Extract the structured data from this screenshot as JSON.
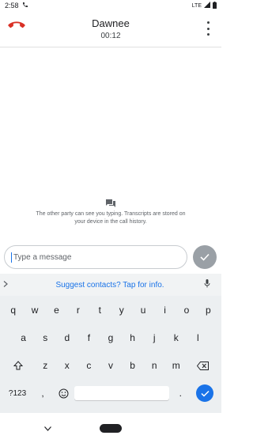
{
  "status_bar": {
    "time": "2:58",
    "network": "LTE"
  },
  "call": {
    "caller_name": "Dawnee",
    "duration": "00:12"
  },
  "transcript_notice": "The other party can see you typing. Transcripts are stored on your device in the call history.",
  "compose": {
    "placeholder": "Type a message"
  },
  "suggestion": {
    "text": "Suggest contacts? Tap for info."
  },
  "keyboard": {
    "row1": [
      "q",
      "w",
      "e",
      "r",
      "t",
      "y",
      "u",
      "i",
      "o",
      "p"
    ],
    "row2": [
      "a",
      "s",
      "d",
      "f",
      "g",
      "h",
      "j",
      "k",
      "l"
    ],
    "row3": [
      "z",
      "x",
      "c",
      "v",
      "b",
      "n",
      "m"
    ],
    "symbols_label": "?123",
    "comma": ",",
    "period": "."
  },
  "colors": {
    "accent": "#1a73e8",
    "hangup": "#d93025",
    "send_disabled": "#9aa0a6"
  }
}
